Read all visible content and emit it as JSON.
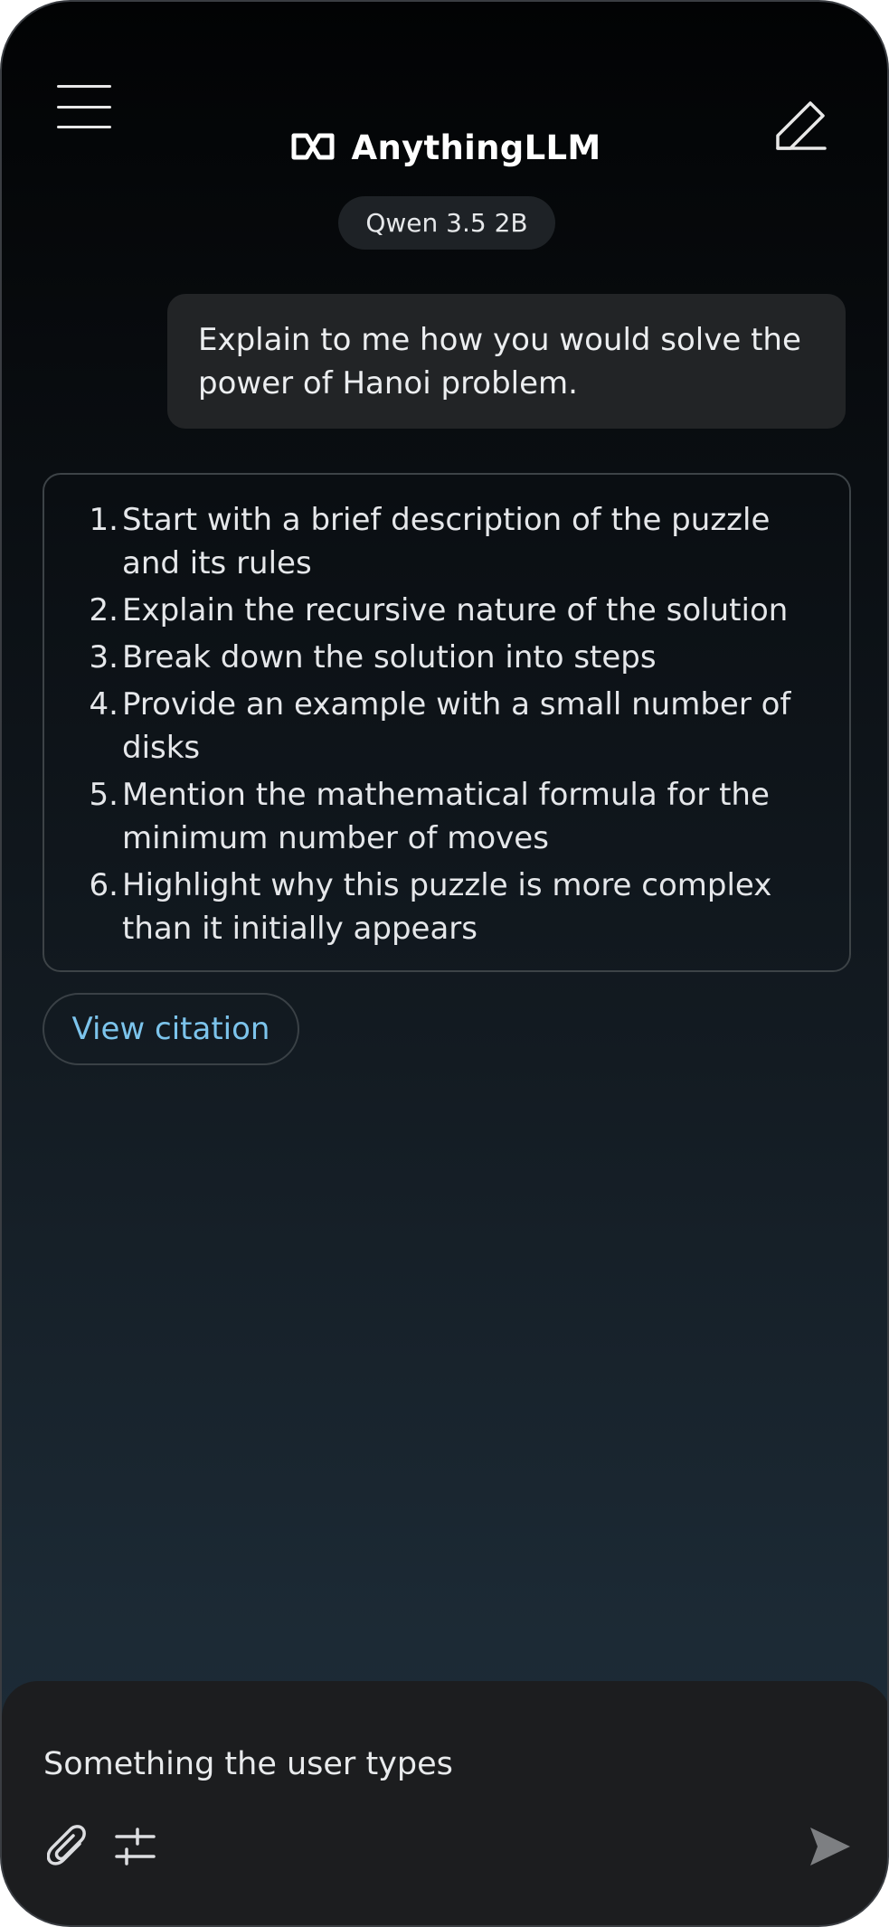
{
  "header": {
    "app_name": "AnythingLLM",
    "model_label": "Qwen 3.5 2B",
    "menu_icon": "hamburger-menu-icon",
    "new_chat_icon": "pencil-edit-icon",
    "logo_icon": "anythingllm-logo-icon"
  },
  "conversation": {
    "user_message": "Explain to me how you would solve the power of Hanoi problem.",
    "assistant_steps": [
      {
        "number": "1.",
        "text": "Start with a brief description of the puzzle and its rules"
      },
      {
        "number": "2.",
        "text": "Explain the recursive nature of the solution"
      },
      {
        "number": "3.",
        "text": "Break down the solution into steps"
      },
      {
        "number": "4.",
        "text": "Provide an example with a small number of disks"
      },
      {
        "number": "5.",
        "text": "Mention the mathematical formula for the minimum number of moves"
      },
      {
        "number": "6.",
        "text": "Highlight why this puzzle is more complex than it initially appears"
      }
    ],
    "citation_label": "View citation"
  },
  "composer": {
    "value": "Something the user types",
    "attach_icon": "paperclip-icon",
    "settings_icon": "sliders-icon",
    "send_icon": "send-arrow-icon"
  },
  "colors": {
    "citation_text": "#7cc4ec",
    "composer_bg": "#1c1d1f",
    "user_bubble_bg": "#222426"
  }
}
